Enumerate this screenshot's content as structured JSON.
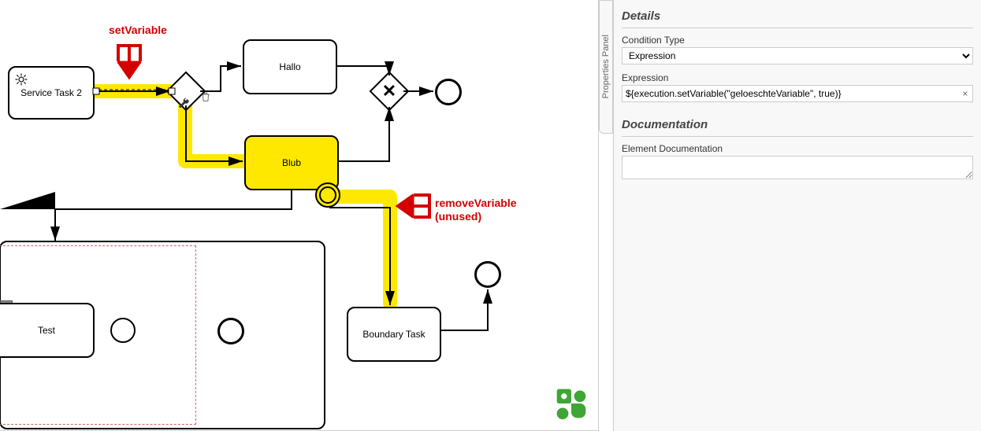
{
  "panel": {
    "tab_label": "Properties Panel",
    "details_heading": "Details",
    "condition_type_label": "Condition Type",
    "condition_type_value": "Expression",
    "expression_label": "Expression",
    "expression_value": "${execution.setVariable(\"geloeschteVariable\", true)}",
    "documentation_heading": "Documentation",
    "element_doc_label": "Element Documentation",
    "element_doc_value": ""
  },
  "canvas": {
    "tasks": {
      "service_task_2": "Service Task 2",
      "hallo": "Hallo",
      "blub": "Blub",
      "test": "Test",
      "boundary_task": "Boundary Task"
    },
    "annotations": {
      "set_variable": "setVariable",
      "remove_variable_line1": "removeVariable",
      "remove_variable_line2": "(unused)"
    },
    "icons": {
      "gear": "gear-icon",
      "wrench": "wrench-icon",
      "trash": "trash-icon"
    }
  }
}
